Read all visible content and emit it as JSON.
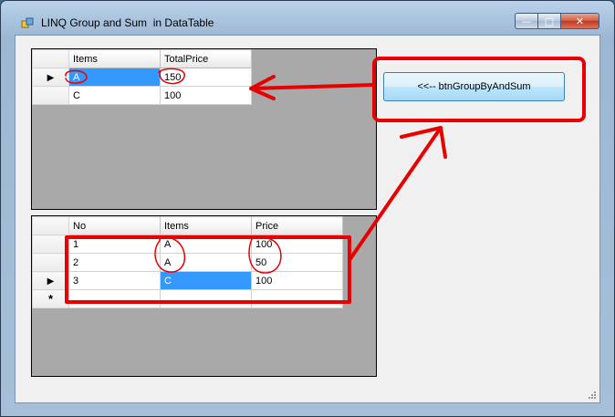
{
  "window": {
    "title": "LINQ Group and Sum  in DataTable",
    "icons": {
      "app": "form-icon",
      "minimize": "minimize-icon",
      "maximize": "maximize-icon",
      "close": "close-icon"
    }
  },
  "result_grid": {
    "columns": [
      "Items",
      "TotalPrice"
    ],
    "rows": [
      {
        "items": "A",
        "total_price": "150",
        "current": true
      },
      {
        "items": "C",
        "total_price": "100",
        "current": false
      }
    ]
  },
  "source_grid": {
    "columns": [
      "No",
      "Items",
      "Price"
    ],
    "rows": [
      {
        "no": "1",
        "items": "A",
        "price": "100",
        "current": false
      },
      {
        "no": "2",
        "items": "A",
        "price": "50",
        "current": false
      },
      {
        "no": "3",
        "items": "C",
        "price": "100",
        "current": true
      }
    ],
    "new_row_marker": "*"
  },
  "actions": {
    "group_button_label": "<<-- btnGroupByAndSum"
  },
  "annotation_color": "#e60000",
  "selection_color": "#3399ff"
}
